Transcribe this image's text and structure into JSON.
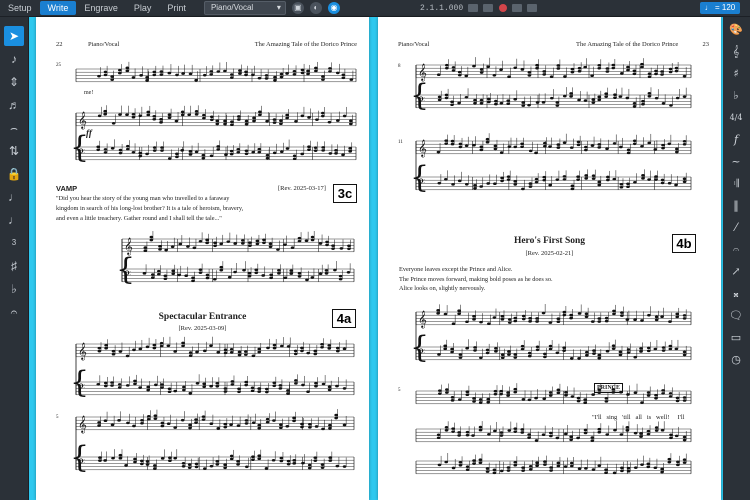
{
  "toolbar": {
    "modes": [
      "Setup",
      "Write",
      "Engrave",
      "Play",
      "Print"
    ],
    "active_mode": "Write",
    "layout_select": "Piano/Vocal",
    "timecode": "2.1.1.000",
    "tempo": "♩ = 120"
  },
  "left_page": {
    "page_number": "22",
    "part_name": "Piano/Vocal",
    "title": "The Amazing Tale of the Dorico Prince",
    "bar_number_1": "25",
    "lyric_1": "me!",
    "dynamic_1": "ff",
    "vamp_label": "VAMP",
    "vamp_text": [
      "\"Did you hear the story of the young man who travelled to a faraway",
      "kingdom in search of his long-lost brother? It is a tale of heroism, bravery,",
      "and even a little treachery. Gather round and I shall tell the tale...\""
    ],
    "rev_3c": "[Rev. 2025-03-17]",
    "rehearsal_3c": "3c",
    "heading_4a": "Spectacular Entrance",
    "rev_4a": "[Rev. 2025-03-09]",
    "rehearsal_4a": "4a",
    "bar_number_5": "5"
  },
  "right_page": {
    "page_number": "23",
    "part_name": "Piano/Vocal",
    "title": "The Amazing Tale of the Dorico Prince",
    "bar_number_8": "8",
    "bar_number_11": "11",
    "heading_4b": "Hero's First Song",
    "rev_4b": "[Rev. 2025-02-21]",
    "rehearsal_4b": "4b",
    "stage_directions": [
      "Everyone leaves except the Prince and Alice.",
      "The Prince moves forward, making bold poses as he does so.",
      "Alice looks on, slightly nervously."
    ],
    "bar_number_b5": "5",
    "character_label": "PRINCE",
    "lyrics": "\"I'll   sing   'till   all   is   well!     I'll"
  },
  "colors": {
    "canvas": "#2ec8ef",
    "chrome": "#2b3138",
    "accent": "#1a8fe0"
  },
  "icons": {
    "left_tools": [
      "select-arrow-icon",
      "note-input-icon",
      "insert-icon",
      "chord-icon",
      "lyrics-icon",
      "lock-icon",
      "key-icon",
      "grace-note-icon",
      "tuplet-icon",
      "rest-icon",
      "slur-icon",
      "voices-icon"
    ],
    "right_tools": [
      "palette-icon",
      "notes-icon",
      "clef-icon",
      "key-signature-icon",
      "time-signature-icon",
      "dynamics-icon",
      "ornaments-icon",
      "repeat-icon",
      "bars-icon",
      "holds-icon",
      "lines-icon",
      "playing-techniques-icon",
      "chord-symbols-icon",
      "comments-icon",
      "text-icon"
    ]
  }
}
